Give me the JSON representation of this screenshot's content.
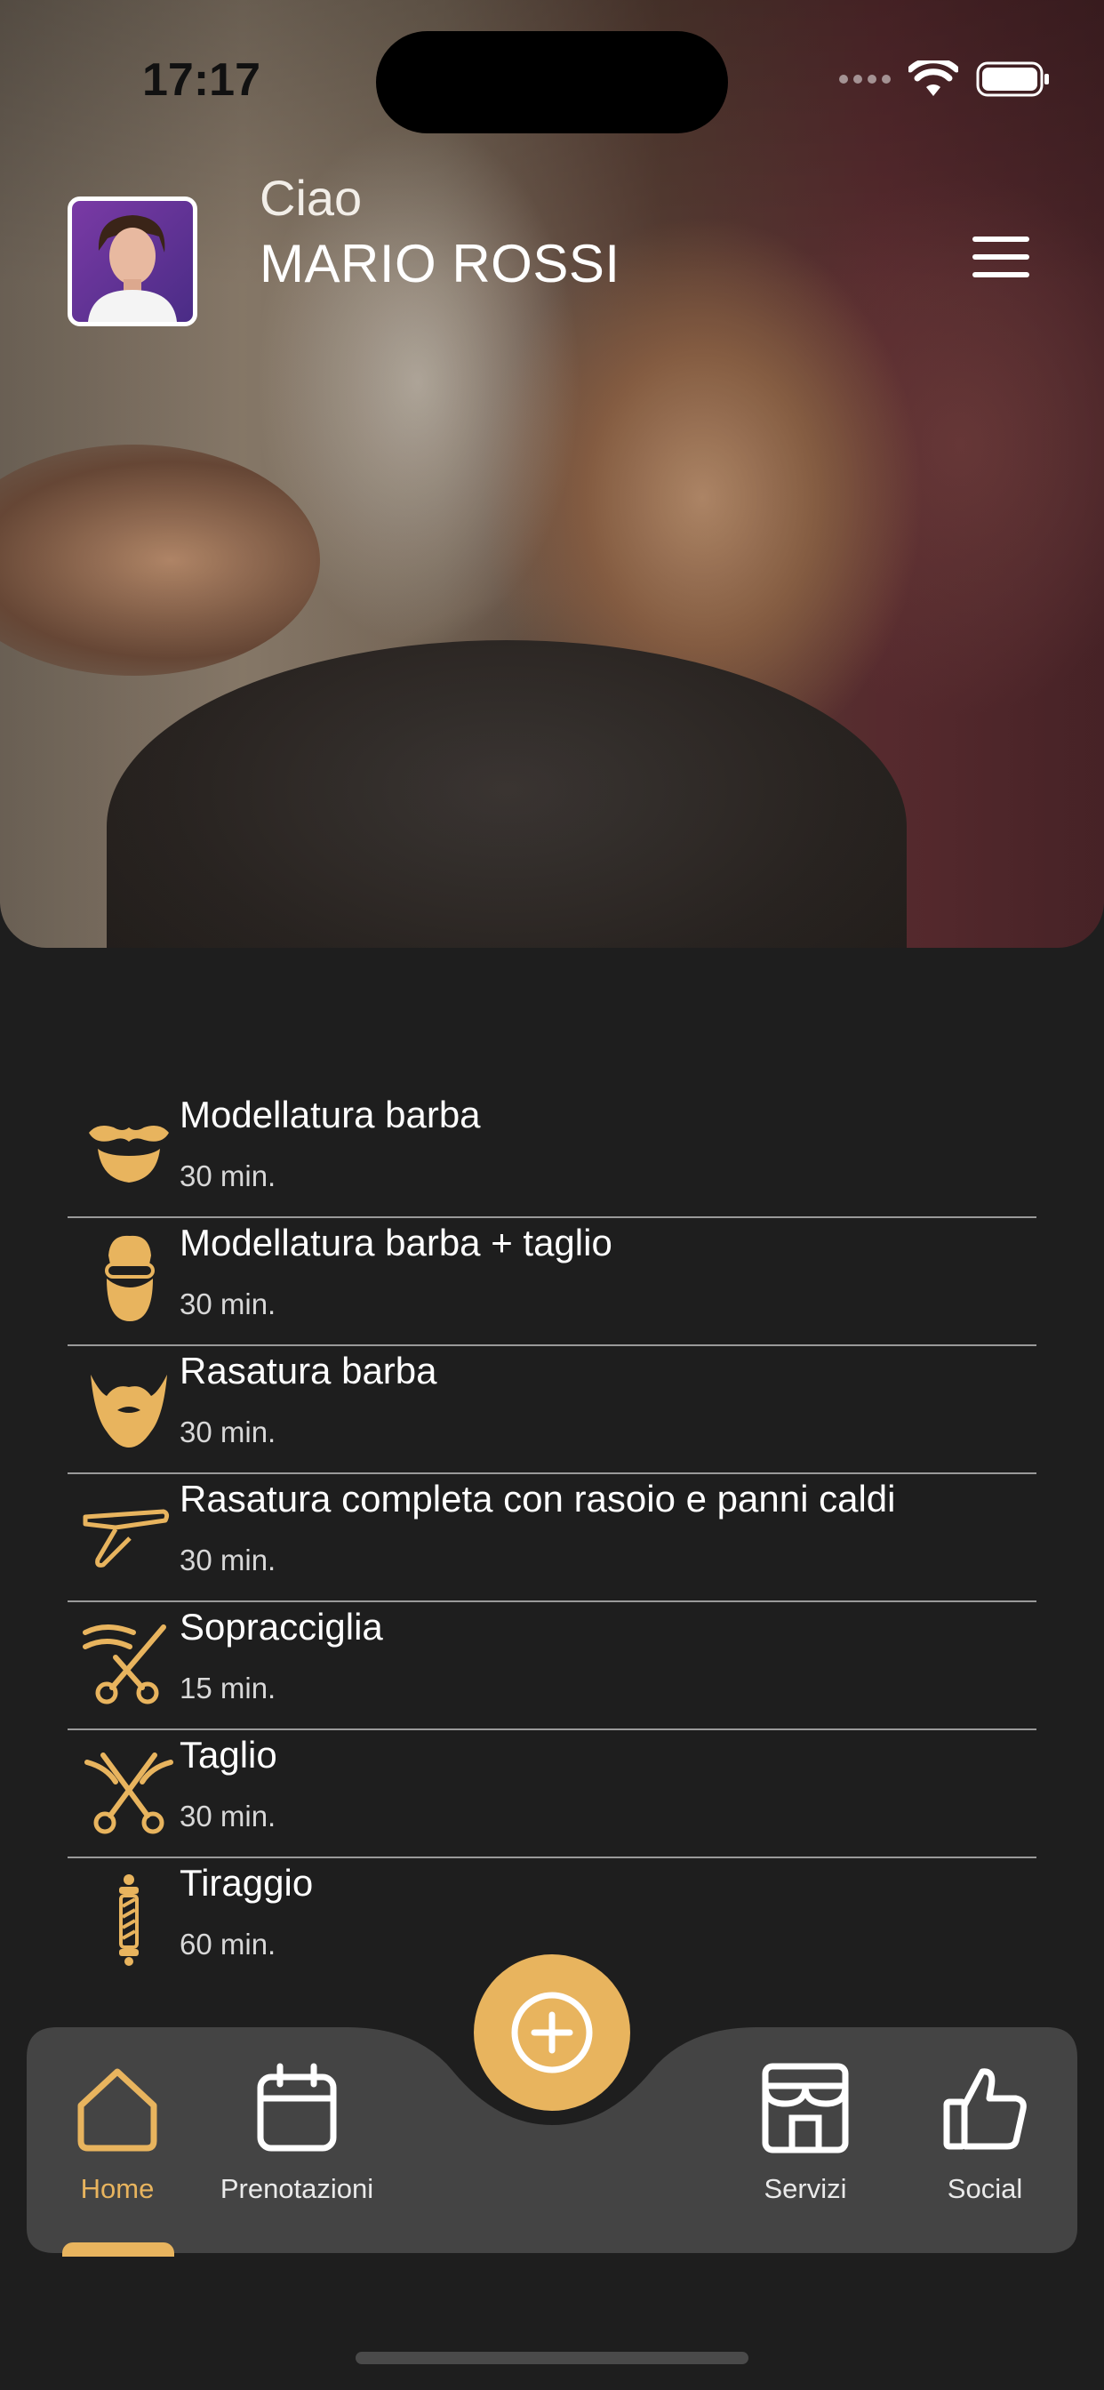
{
  "status_bar": {
    "time": "17:17"
  },
  "header": {
    "greeting": "Ciao",
    "user_name": "MARIO ROSSI"
  },
  "services": [
    {
      "name": "Modellatura barba",
      "duration": "30 min.",
      "icon": "mustache-icon"
    },
    {
      "name": "Modellatura barba + taglio",
      "duration": "30 min.",
      "icon": "bearded-face-icon"
    },
    {
      "name": "Rasatura barba",
      "duration": "30 min.",
      "icon": "beard-icon"
    },
    {
      "name": "Rasatura completa con rasoio e panni caldi",
      "duration": "30 min.",
      "icon": "razor-icon"
    },
    {
      "name": "Sopracciglia",
      "duration": "15 min.",
      "icon": "eyebrow-scissors-icon"
    },
    {
      "name": "Taglio",
      "duration": "30 min.",
      "icon": "scissors-icon"
    },
    {
      "name": "Tiraggio",
      "duration": "60 min.",
      "icon": "barber-pole-icon"
    }
  ],
  "nav": {
    "items": [
      {
        "label": "Home",
        "icon": "home-icon",
        "active": true
      },
      {
        "label": "Prenotazioni",
        "icon": "calendar-icon",
        "active": false
      },
      {
        "label": "Servizi",
        "icon": "shop-icon",
        "active": false
      },
      {
        "label": "Social",
        "icon": "thumbs-up-icon",
        "active": false
      }
    ],
    "fab_icon": "plus-circle-icon"
  },
  "colors": {
    "accent": "#e8b45e",
    "background": "#1e1e1e",
    "nav_bar": "#444444"
  }
}
